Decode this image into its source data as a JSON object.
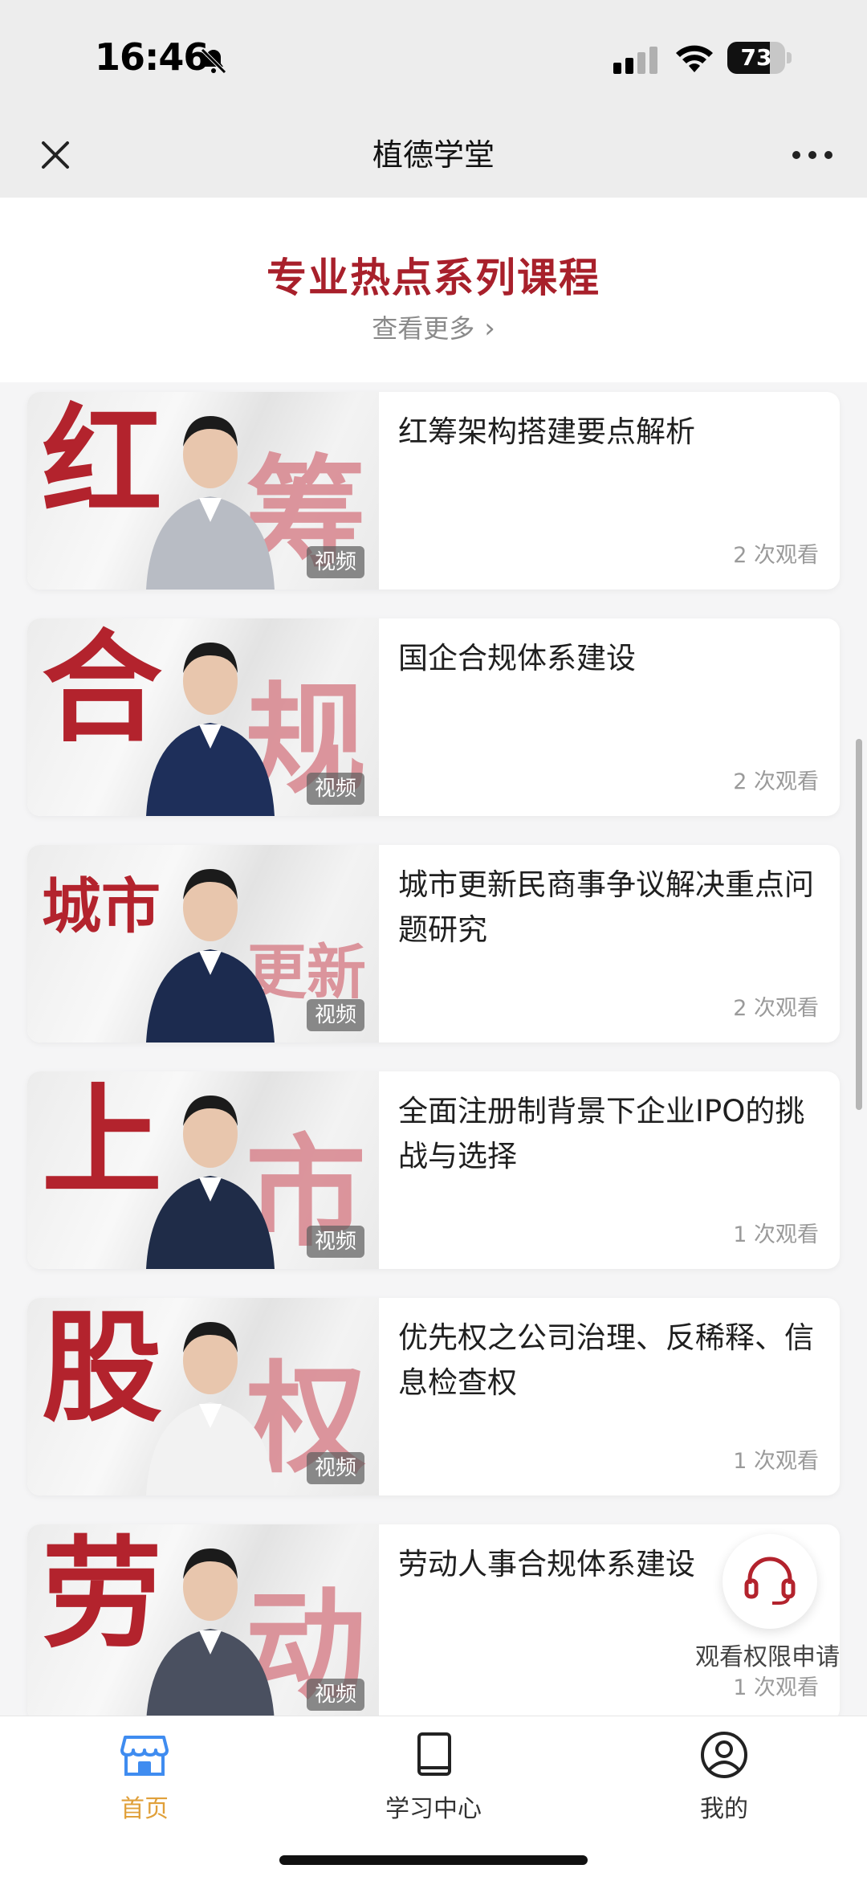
{
  "status_bar": {
    "time": "16:46",
    "battery_level": "73"
  },
  "nav": {
    "title": "植德学堂"
  },
  "section": {
    "title": "专业热点系列课程",
    "see_more": "查看更多"
  },
  "courses": [
    {
      "title": "红筹架构搭建要点解析",
      "views": "2 次观看",
      "tag": "视频",
      "thumb_a": "红",
      "thumb_b": "筹"
    },
    {
      "title": "国企合规体系建设",
      "views": "2 次观看",
      "tag": "视频",
      "thumb_a": "合",
      "thumb_b": "规"
    },
    {
      "title": "城市更新民商事争议解决重点问题研究",
      "views": "2 次观看",
      "tag": "视频",
      "thumb_a": "城市",
      "thumb_b": "更新"
    },
    {
      "title": "全面注册制背景下企业IPO的挑战与选择",
      "views": "1 次观看",
      "tag": "视频",
      "thumb_a": "上",
      "thumb_b": "市"
    },
    {
      "title": "优先权之公司治理、反稀释、信息检查权",
      "views": "1 次观看",
      "tag": "视频",
      "thumb_a": "股",
      "thumb_b": "权"
    },
    {
      "title": "劳动人事合规体系建设",
      "views": "1 次观看",
      "tag": "视频",
      "thumb_a": "劳",
      "thumb_b": "动"
    }
  ],
  "floating": {
    "label": "观看权限申请"
  },
  "tabbar": {
    "items": [
      {
        "label": "首页",
        "icon": "home-store-icon"
      },
      {
        "label": "学习中心",
        "icon": "book-icon"
      },
      {
        "label": "我的",
        "icon": "profile-icon"
      }
    ]
  },
  "colors": {
    "accent_red": "#a8202b",
    "active_tab": "#e0a03a",
    "home_icon_blue": "#3f8cf0"
  }
}
